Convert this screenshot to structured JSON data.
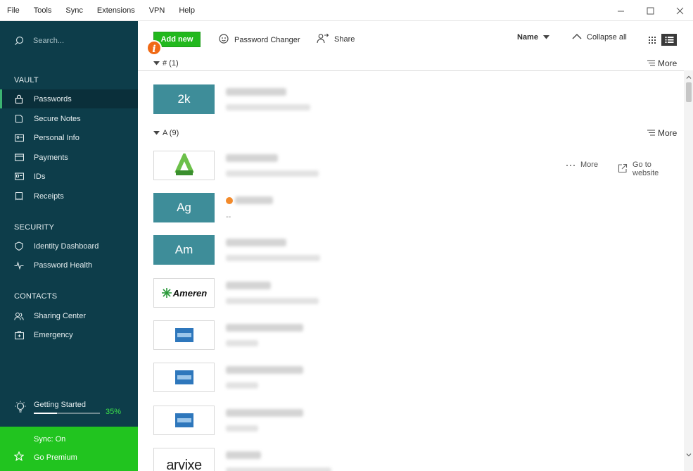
{
  "menu": [
    "File",
    "Tools",
    "Sync",
    "Extensions",
    "VPN",
    "Help"
  ],
  "sidebar": {
    "search_placeholder": "Search...",
    "vault_heading": "VAULT",
    "vault_items": [
      "Passwords",
      "Secure Notes",
      "Personal Info",
      "Payments",
      "IDs",
      "Receipts"
    ],
    "security_heading": "SECURITY",
    "security_items": [
      "Identity Dashboard",
      "Password Health"
    ],
    "contacts_heading": "CONTACTS",
    "contacts_items": [
      "Sharing Center",
      "Emergency"
    ],
    "getting_started": {
      "label": "Getting Started",
      "percent_text": "35%",
      "progress": 0.35
    },
    "sync_label": "Sync: On",
    "premium_label": "Go Premium"
  },
  "toolbar": {
    "add_new": "Add new",
    "info_badge": "i",
    "password_changer": "Password Changer",
    "share": "Share",
    "sort_label": "Name",
    "collapse_all": "Collapse all"
  },
  "groups": [
    {
      "header": "# (1)",
      "more": "More"
    },
    {
      "header": "A (9)",
      "more": "More"
    }
  ],
  "thumb_labels": {
    "r1": "2k",
    "r3": "Ag",
    "r4": "Am",
    "ameren": "Ameren",
    "arvixe": "arvixe"
  },
  "row_actions": {
    "more": "More",
    "go_to_website": "Go to website"
  },
  "placeholder_dash": "--",
  "colors": {
    "sidebar_bg": "#0d3d4a",
    "accent_green": "#22b81d",
    "teal_thumb": "#3e8d99",
    "info_orange": "#f06a16"
  }
}
